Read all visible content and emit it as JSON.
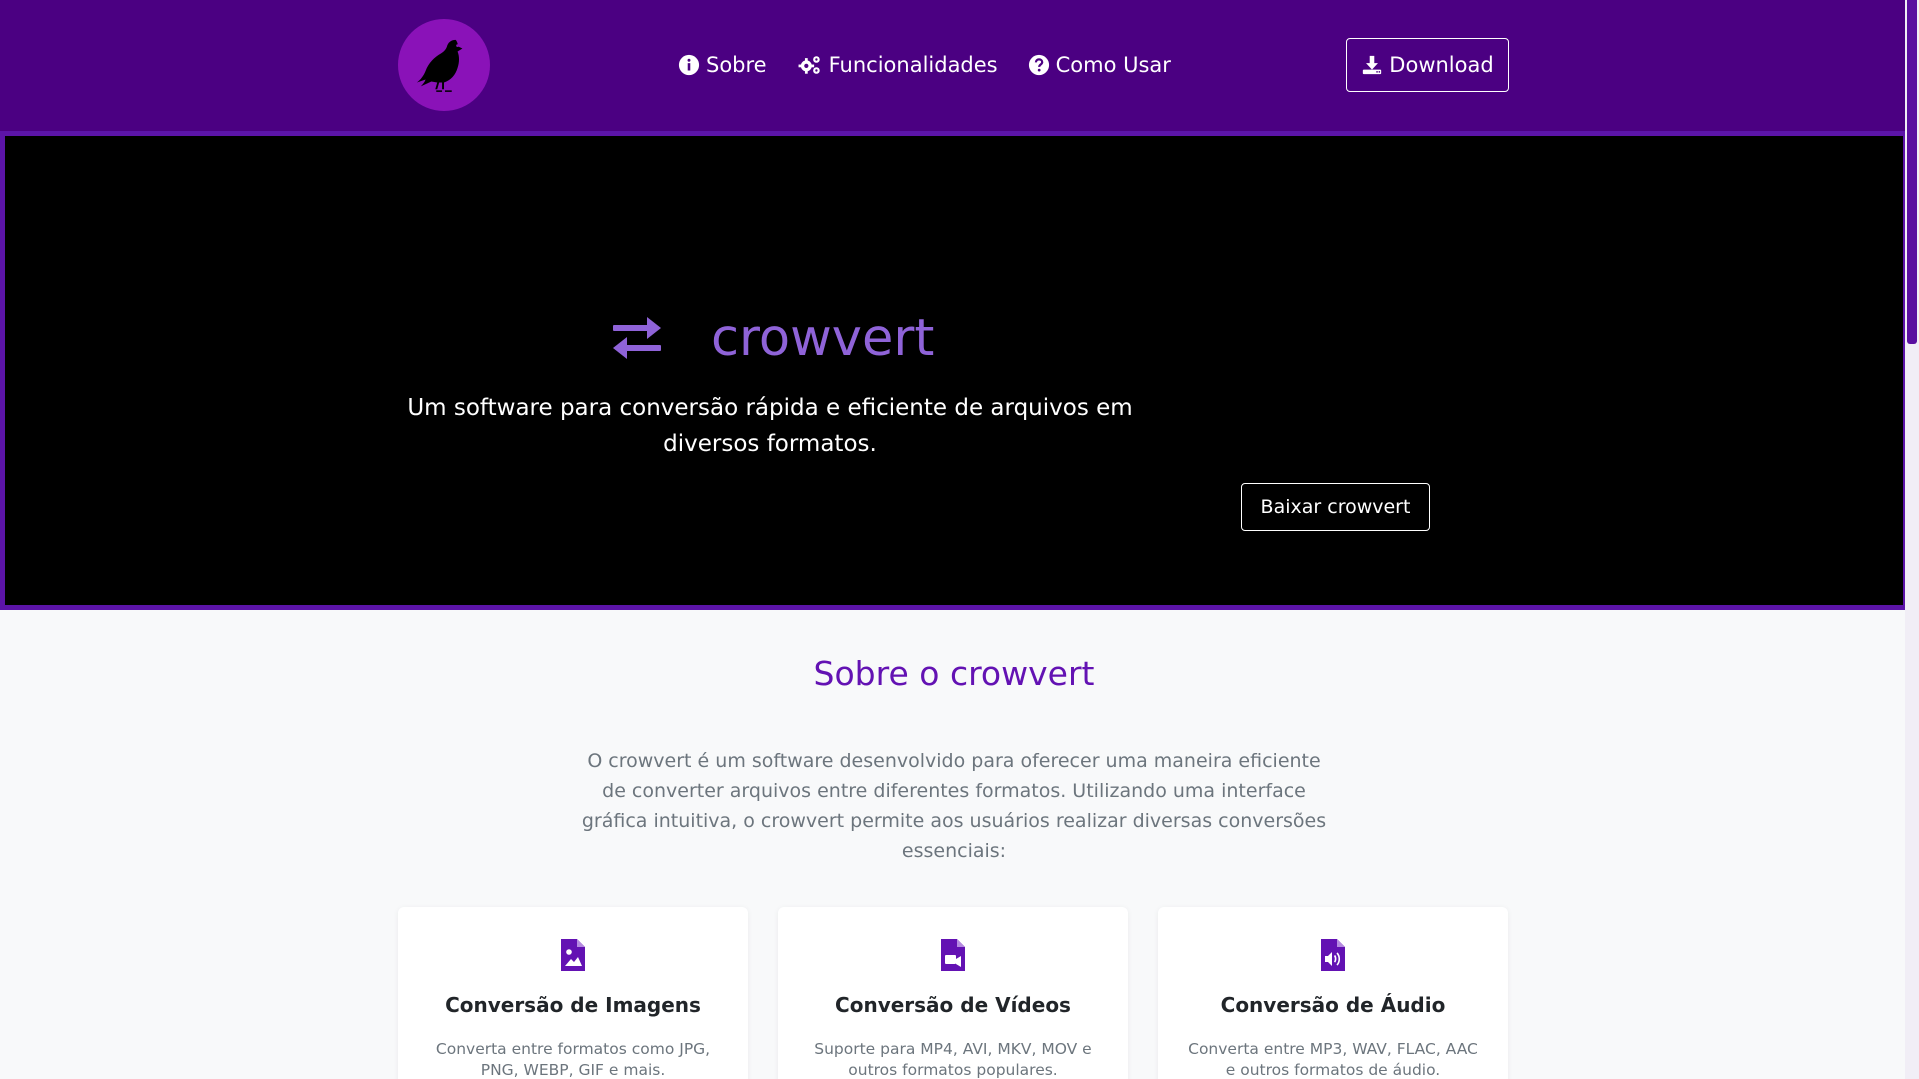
{
  "colors": {
    "navbar_bg": "#4b0082",
    "accent_purple": "#6312b3",
    "hero_title": "#8f63d8",
    "hero_bg": "#000000",
    "page_bg": "#f8f9fa",
    "muted_text": "#6c757d"
  },
  "navbar": {
    "logo_icon": "crow-icon",
    "links": [
      {
        "label": "Sobre",
        "icon": "info-circle-icon"
      },
      {
        "label": "Funcionalidades",
        "icon": "gears-icon"
      },
      {
        "label": "Como Usar",
        "icon": "question-circle-icon"
      }
    ],
    "download_label": "Download",
    "download_icon": "download-icon"
  },
  "hero": {
    "icon": "exchange-arrows-icon",
    "title": "crowvert",
    "subtitle": "Um software para conversão rápida e eficiente de arquivos em diversos formatos.",
    "button_label": "Baixar crowvert"
  },
  "about": {
    "title": "Sobre o crowvert",
    "text": "O crowvert é um software desenvolvido para oferecer uma maneira eficiente de converter arquivos entre diferentes formatos. Utilizando uma interface gráfica intuitiva, o crowvert permite aos usuários realizar diversas conversões essenciais:"
  },
  "features": [
    {
      "icon": "file-image-icon",
      "title": "Conversão de Imagens",
      "text": "Converta entre formatos como JPG, PNG, WEBP, GIF e mais."
    },
    {
      "icon": "file-video-icon",
      "title": "Conversão de Vídeos",
      "text": "Suporte para MP4, AVI, MKV, MOV e outros formatos populares."
    },
    {
      "icon": "file-audio-icon",
      "title": "Conversão de Áudio",
      "text": "Converta entre MP3, WAV, FLAC, AAC e outros formatos de áudio."
    }
  ]
}
